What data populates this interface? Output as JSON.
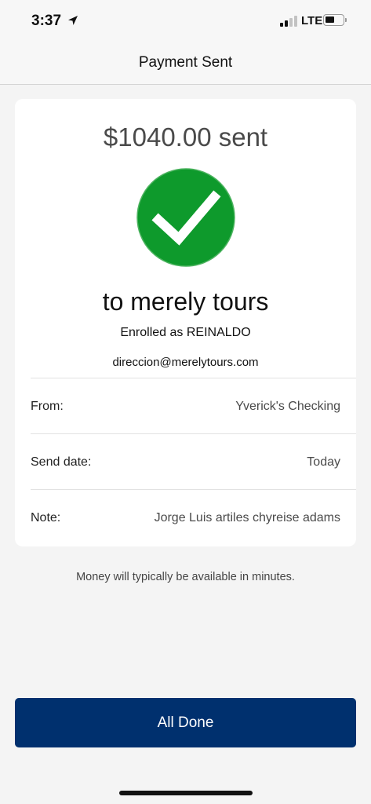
{
  "status_bar": {
    "time": "3:37",
    "network": "LTE"
  },
  "header": {
    "title": "Payment Sent"
  },
  "confirmation": {
    "amount_text": "$1040.00 sent",
    "recipient_text": "to merely tours",
    "enrolled_text": "Enrolled as REINALDO",
    "email": "direccion@merelytours.com",
    "success_color": "#0e9a2c"
  },
  "details": [
    {
      "label": "From:",
      "value": "Yverick's Checking"
    },
    {
      "label": "Send date:",
      "value": "Today"
    },
    {
      "label": "Note:",
      "value": "Jorge Luis artiles chyreise adams"
    }
  ],
  "info": {
    "text": "Money will typically be available in minutes."
  },
  "actions": {
    "done_label": "All Done",
    "button_color": "#00306e"
  }
}
